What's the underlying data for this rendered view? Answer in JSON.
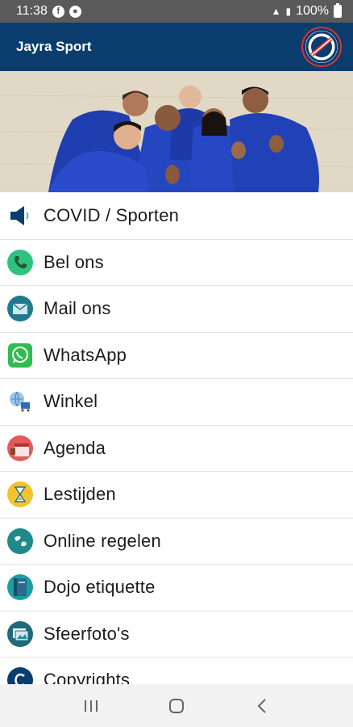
{
  "status_bar": {
    "time": "11:38",
    "battery": "100%"
  },
  "app_bar": {
    "title": "Jayra Sport"
  },
  "menu": {
    "items": [
      {
        "label": "COVID / Sporten",
        "icon": "speaker-icon"
      },
      {
        "label": "Bel ons",
        "icon": "phone-icon"
      },
      {
        "label": "Mail ons",
        "icon": "mail-icon"
      },
      {
        "label": "WhatsApp",
        "icon": "whatsapp-icon"
      },
      {
        "label": "Winkel",
        "icon": "shop-icon"
      },
      {
        "label": "Agenda",
        "icon": "calendar-icon"
      },
      {
        "label": "Lestijden",
        "icon": "hourglass-icon"
      },
      {
        "label": "Online regelen",
        "icon": "globe-icon"
      },
      {
        "label": "Dojo etiquette",
        "icon": "book-icon"
      },
      {
        "label": "Sfeerfoto's",
        "icon": "photo-icon"
      },
      {
        "label": "Copyrights",
        "icon": "copyright-icon"
      }
    ]
  },
  "colors": {
    "app_bar": "#0a3d6e",
    "status_bar": "#5a5a5a",
    "nav_bar": "#f2f2f2"
  }
}
